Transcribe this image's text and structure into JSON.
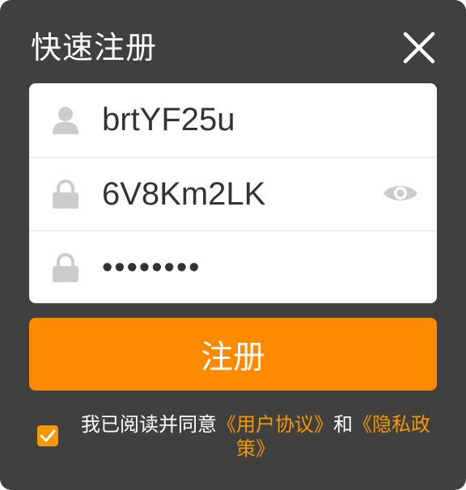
{
  "dialog": {
    "title": "快速注册"
  },
  "form": {
    "username": {
      "value": "brtYF25u",
      "icon": "user-icon"
    },
    "password": {
      "value": "6V8Km2LK",
      "icon": "lock-icon",
      "toggle_icon": "eye-icon"
    },
    "confirm_password": {
      "value": "••••••••",
      "icon": "lock-icon"
    }
  },
  "submit_label": "注册",
  "agreement": {
    "checked": true,
    "prefix": "我已阅读并同意",
    "link1": "《用户协议》",
    "connector": "和",
    "link2": "《隐私政策》"
  },
  "colors": {
    "accent": "#ff8a00",
    "background": "#404040",
    "icon_gray": "#cccccc"
  }
}
